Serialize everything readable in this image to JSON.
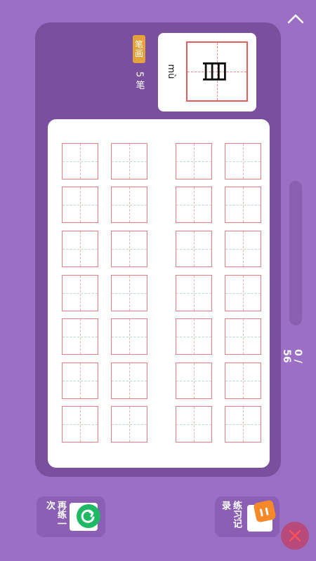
{
  "character": {
    "glyph": "目",
    "pinyin": "mù",
    "stroke_badge": "笔画",
    "stroke_count": "5 笔"
  },
  "progress": {
    "text": "0 / 56"
  },
  "buttons": {
    "retry_label": "再练一次",
    "record_label": "练习记录"
  },
  "colors": {
    "background": "#9b6fc4",
    "panel": "#7a4f9e",
    "grid_line": "#e08080",
    "badge": "#e6a23a",
    "retry_icon": "#1fb865",
    "record_icon": "#f5892a",
    "close": "#b54a7b"
  },
  "icons": {
    "top": "chevron-up-icon",
    "retry": "refresh-icon",
    "record": "notebook-icon",
    "close": "close-icon"
  }
}
